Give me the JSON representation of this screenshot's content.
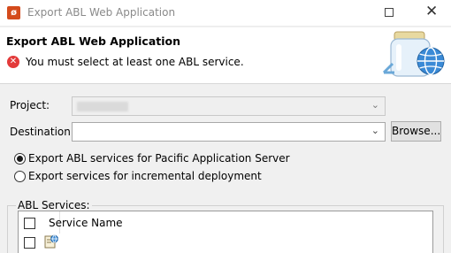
{
  "window": {
    "title": "Export ABL Web Application",
    "app_icon": "openedge-icon",
    "buttons": [
      "maximize-icon",
      "close-icon"
    ]
  },
  "header": {
    "title": "Export ABL Web Application",
    "error_message": "You must select at least one ABL service.",
    "error_icon": "error-icon",
    "banner_icon": "web-jar-globe-icon"
  },
  "form": {
    "project_label": "Project:",
    "project_value": "",
    "destination_label": "Destination:",
    "destination_value": "",
    "browse_button": "Browse..."
  },
  "options": {
    "pas_label": "Export ABL services for Pacific Application Server",
    "pas_selected": true,
    "incremental_label": "Export services for incremental deployment",
    "incremental_selected": false
  },
  "services": {
    "group_label": "ABL Services:",
    "columns": [
      "Service Name"
    ],
    "rows": [
      {
        "icon": "abl-service-icon",
        "name": "",
        "checked": false
      }
    ]
  },
  "colors": {
    "error": "#e33a3a",
    "app_icon": "#d44b1c",
    "header_bg": "#ffffff",
    "dialog_bg": "#f0f0f0"
  }
}
